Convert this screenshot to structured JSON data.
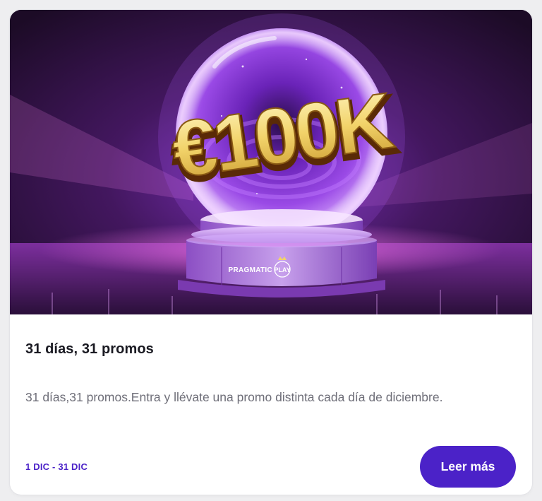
{
  "promo": {
    "banner": {
      "amount_text": "€100K",
      "brand_text": "PRAGMATIC PLAY",
      "brand_word_1": "PRAGMATIC",
      "brand_word_2": "PLAY"
    },
    "title": "31 días, 31 promos",
    "description": "31 días,31 promos.Entra y llévate una promo distinta cada día de diciembre.",
    "dates": "1 DIC - 31 DIC",
    "cta_label": "Leer más"
  },
  "colors": {
    "accent": "#4b22c8",
    "title": "#1a1a22",
    "body_text": "#6e6e78",
    "card_bg": "#ffffff"
  },
  "icons": [
    "crystal-ball-icon",
    "pragmatic-play-logo"
  ]
}
